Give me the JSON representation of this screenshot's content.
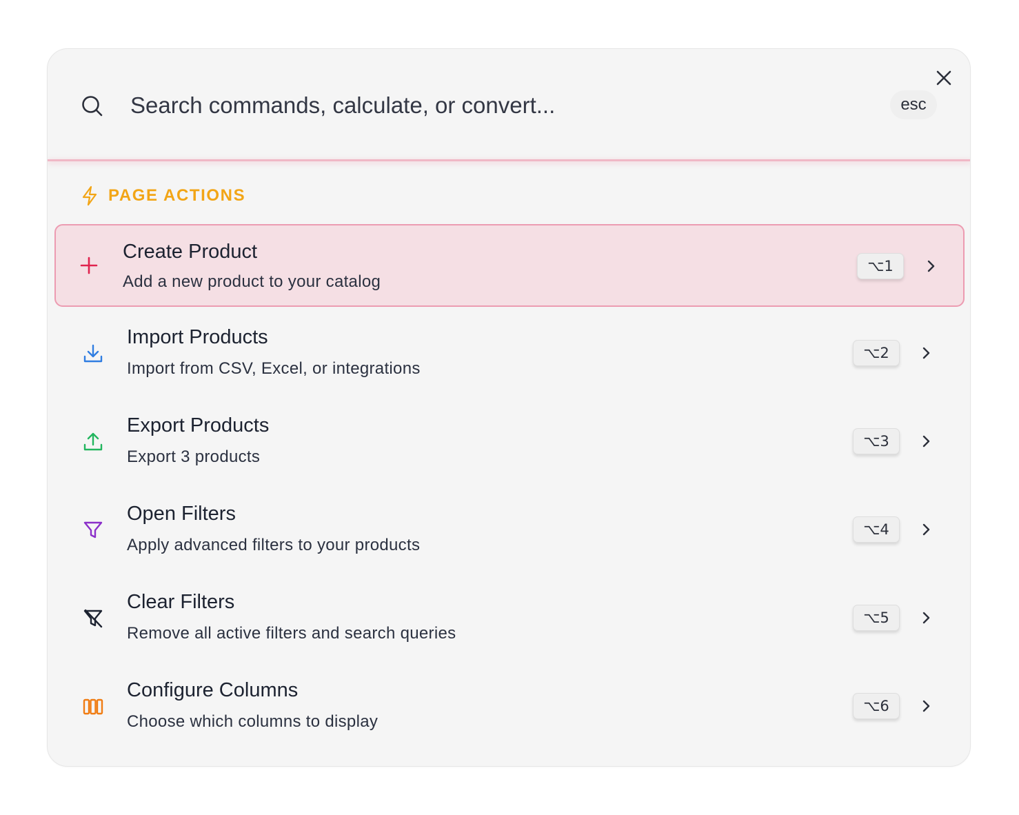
{
  "search": {
    "placeholder": "Search commands, calculate, or convert...",
    "value": "",
    "esc_label": "esc"
  },
  "section": {
    "label": "PAGE ACTIONS",
    "icon": "lightning-icon",
    "color": "#f2a516"
  },
  "items": [
    {
      "title": "Create Product",
      "description": "Add a new product to your catalog",
      "shortcut": "⌥1",
      "icon": "plus-icon",
      "color": "#e0234e",
      "active": true
    },
    {
      "title": "Import Products",
      "description": "Import from CSV, Excel, or integrations",
      "shortcut": "⌥2",
      "icon": "download-icon",
      "color": "#2f7de1",
      "active": false
    },
    {
      "title": "Export Products",
      "description": "Export 3 products",
      "shortcut": "⌥3",
      "icon": "upload-icon",
      "color": "#22b55e",
      "active": false
    },
    {
      "title": "Open Filters",
      "description": "Apply advanced filters to your products",
      "shortcut": "⌥4",
      "icon": "filter-icon",
      "color": "#8b2fc9",
      "active": false
    },
    {
      "title": "Clear Filters",
      "description": "Remove all active filters and search queries",
      "shortcut": "⌥5",
      "icon": "filter-off-icon",
      "color": "#1c2230",
      "active": false
    },
    {
      "title": "Configure Columns",
      "description": "Choose which columns to display",
      "shortcut": "⌥6",
      "icon": "columns-icon",
      "color": "#f07c12",
      "active": false
    }
  ]
}
